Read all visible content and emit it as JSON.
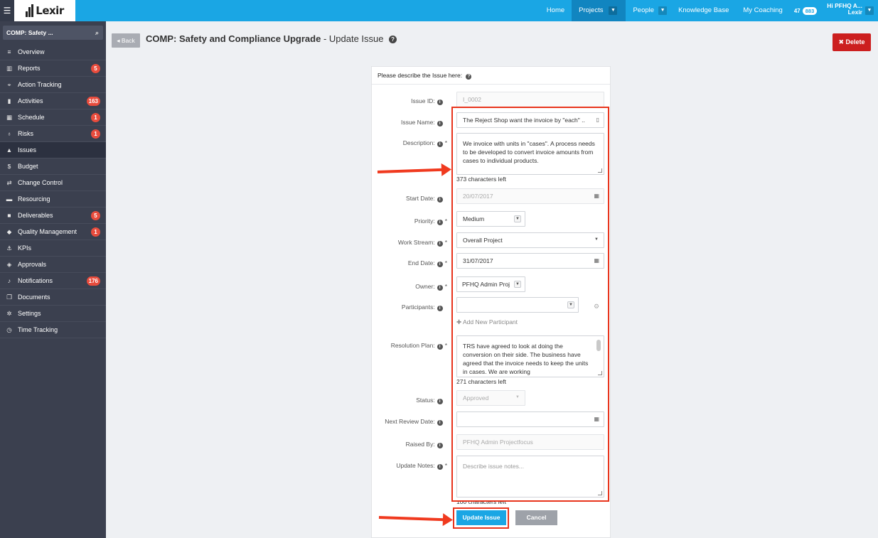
{
  "topbar": {
    "menu_icon": "hamburger-icon",
    "logo_text": "Lexir",
    "nav": {
      "home": "Home",
      "projects": "Projects",
      "people": "People",
      "knowledge_base": "Knowledge Base",
      "my_coaching": "My Coaching"
    },
    "counts": {
      "first": "47",
      "second": "883"
    },
    "user": {
      "greeting": "Hi PFHQ A...",
      "org": "Lexir"
    }
  },
  "sidebar": {
    "search_text": "COMP: Safety ...",
    "items": [
      {
        "label": "Overview",
        "icon": "list-icon",
        "badge": ""
      },
      {
        "label": "Reports",
        "icon": "bar-chart-icon",
        "badge": "5"
      },
      {
        "label": "Action Tracking",
        "icon": "crosshair-icon",
        "badge": ""
      },
      {
        "label": "Activities",
        "icon": "bookmark-icon",
        "badge": "163"
      },
      {
        "label": "Schedule",
        "icon": "calendar-icon",
        "badge": "1"
      },
      {
        "label": "Risks",
        "icon": "lightbulb-icon",
        "badge": "1"
      },
      {
        "label": "Issues",
        "icon": "warning-icon",
        "badge": ""
      },
      {
        "label": "Budget",
        "icon": "dollar-icon",
        "badge": ""
      },
      {
        "label": "Change Control",
        "icon": "exchange-icon",
        "badge": ""
      },
      {
        "label": "Resourcing",
        "icon": "folder-icon",
        "badge": ""
      },
      {
        "label": "Deliverables",
        "icon": "truck-icon",
        "badge": "5"
      },
      {
        "label": "Quality Management",
        "icon": "tag-icon",
        "badge": "1"
      },
      {
        "label": "KPIs",
        "icon": "anchor-icon",
        "badge": ""
      },
      {
        "label": "Approvals",
        "icon": "gavel-icon",
        "badge": ""
      },
      {
        "label": "Notifications",
        "icon": "bell-icon",
        "badge": "176"
      },
      {
        "label": "Documents",
        "icon": "documents-icon",
        "badge": ""
      },
      {
        "label": "Settings",
        "icon": "gears-icon",
        "badge": ""
      },
      {
        "label": "Time Tracking",
        "icon": "clock-icon",
        "badge": ""
      }
    ]
  },
  "header": {
    "back_label": "Back",
    "project_name": "COMP: Safety and Compliance Upgrade",
    "subtitle": " - Update Issue",
    "delete_label": "Delete"
  },
  "form": {
    "heading": "Please describe the Issue here:",
    "issue_id": {
      "label": "Issue ID:",
      "value": "I_0002"
    },
    "issue_name": {
      "label": "Issue Name:",
      "value": "The Reject Shop want the invoice by \"each\" .."
    },
    "description": {
      "label": "Description:",
      "value": "We invoice with units in \"cases\". A process needs to be developed to convert invoice amounts from cases to individual products.",
      "chars_left": "373 characters left"
    },
    "start_date": {
      "label": "Start Date:",
      "value": "20/07/2017"
    },
    "priority": {
      "label": "Priority:",
      "value": "Medium"
    },
    "work_stream": {
      "label": "Work Stream:",
      "value": "Overall Project"
    },
    "end_date": {
      "label": "End Date:",
      "value": "31/07/2017"
    },
    "owner": {
      "label": "Owner:",
      "value": "PFHQ Admin Proj"
    },
    "participants": {
      "label": "Participants:",
      "value": "",
      "add_label": "Add New Participant"
    },
    "resolution_plan": {
      "label": "Resolution Plan:",
      "value": "TRS have agreed to look at doing the conversion on their side. The business have agreed that the invoice needs to keep the units in cases. We are working",
      "chars_left": "271 characters left"
    },
    "status": {
      "label": "Status:",
      "value": "Approved"
    },
    "next_review_date": {
      "label": "Next Review Date:",
      "value": ""
    },
    "raised_by": {
      "label": "Raised By:",
      "value": "PFHQ Admin Projectfocus"
    },
    "update_notes": {
      "label": "Update Notes:",
      "placeholder": "Describe issue notes...",
      "chars_left": "100 characters left"
    },
    "update_label": "Update Issue",
    "cancel_label": "Cancel"
  },
  "annotation_color": "#e8341c"
}
